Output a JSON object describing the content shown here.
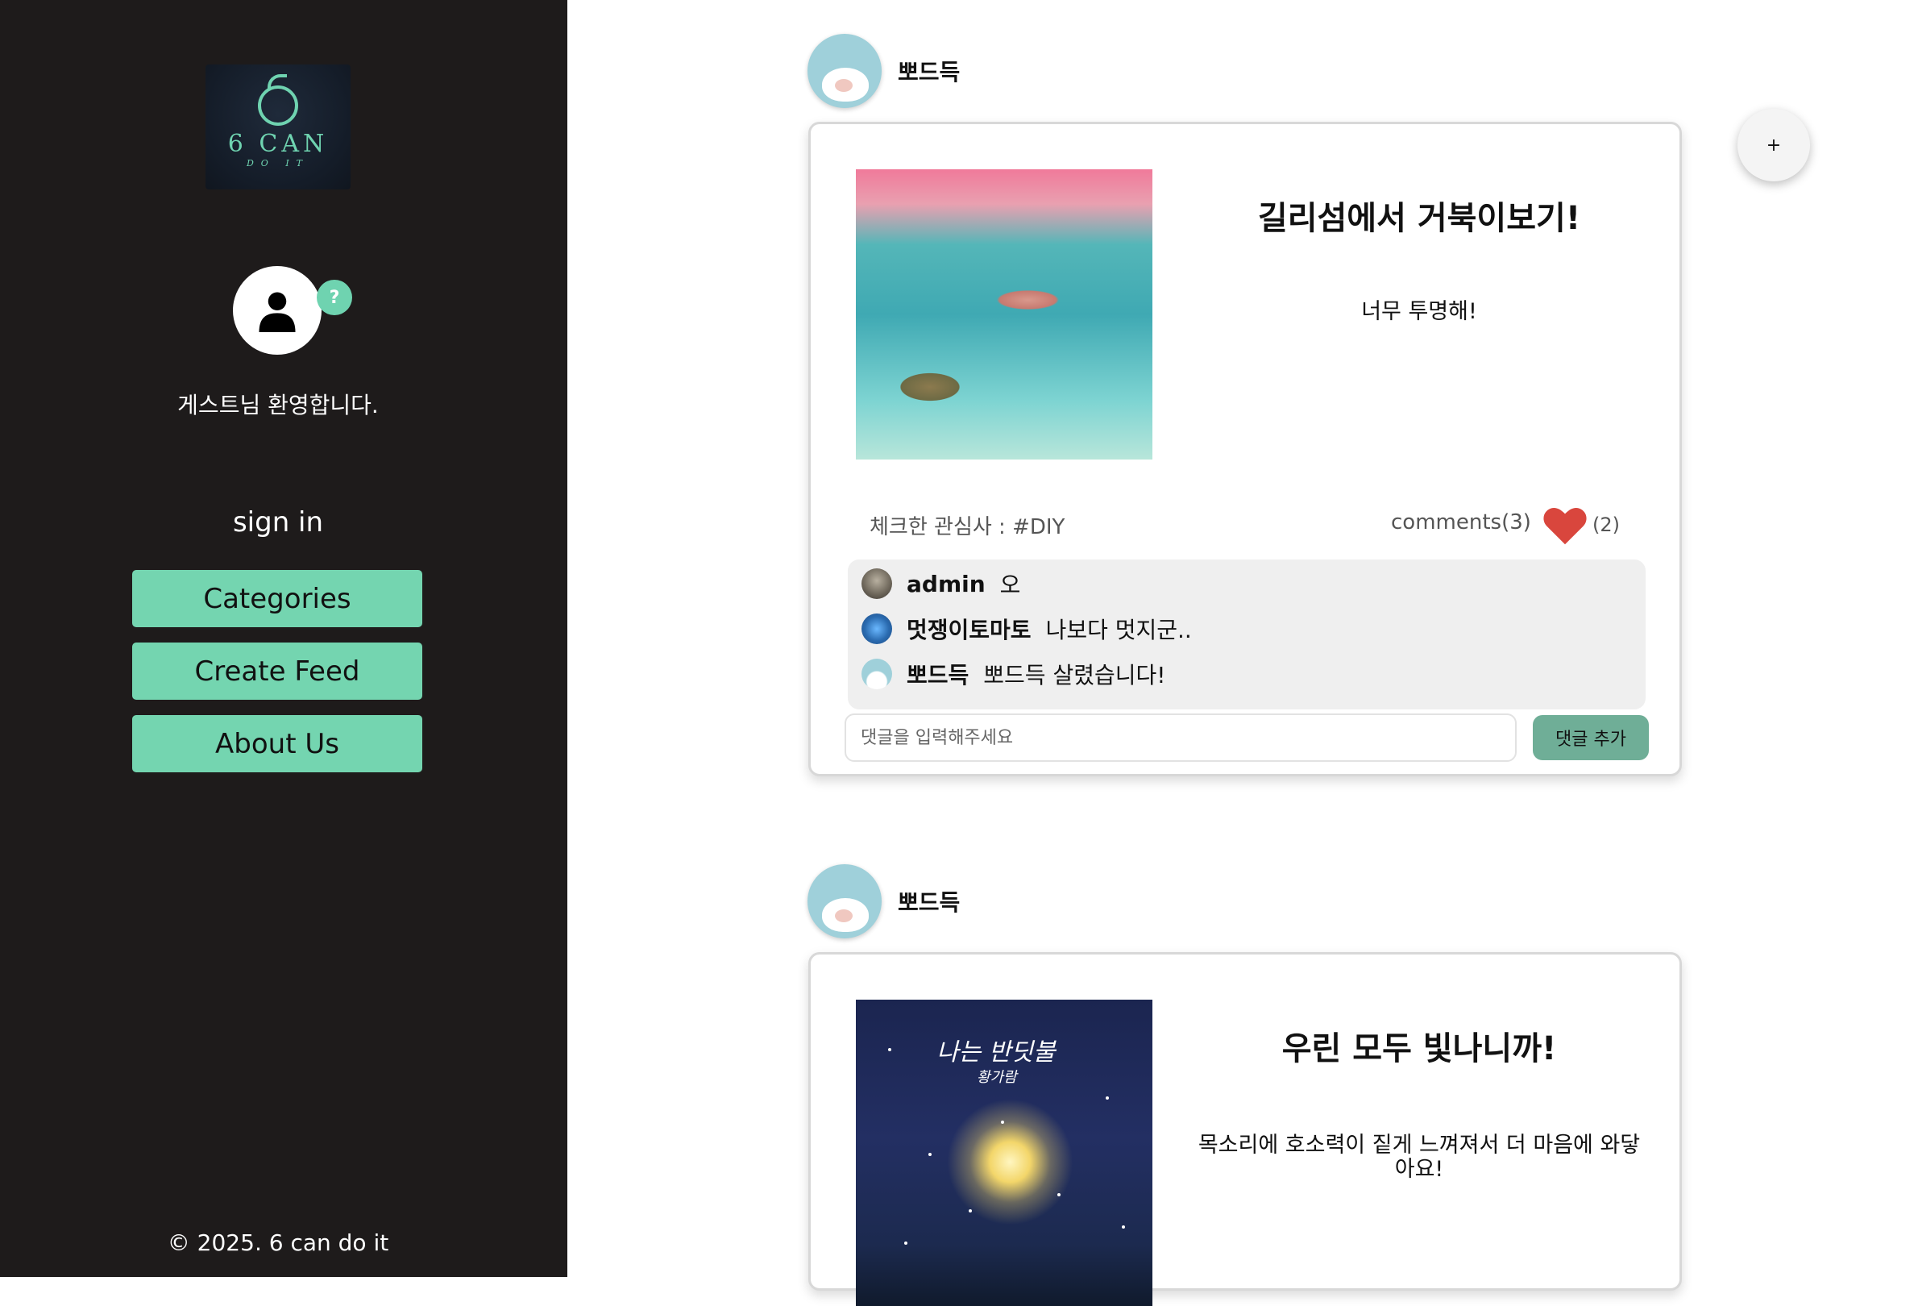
{
  "sidebar": {
    "logo": {
      "main": "6 CAN",
      "sub": "DO IT"
    },
    "help_badge": "?",
    "welcome": "게스트님 환영합니다.",
    "signin": "sign in",
    "nav": [
      "Categories",
      "Create Feed",
      "About Us"
    ],
    "footer": "© 2025. 6 can do it"
  },
  "fab": {
    "label": "+"
  },
  "feeds": [
    {
      "author": "뽀드득",
      "title": "길리섬에서 거북이보기!",
      "body": "너무 투명해!",
      "interest": "체크한 관심사 : #DIY",
      "comments_label": "comments(3)",
      "likes": "(2)",
      "comments": [
        {
          "user": "admin",
          "text": "오"
        },
        {
          "user": "멋쟁이토마토",
          "text": "나보다 멋지군.."
        },
        {
          "user": "뽀드득",
          "text": "뽀드득 살렸습니다!"
        }
      ],
      "comment_placeholder": "댓글을 입력해주세요",
      "comment_submit": "댓글 추가"
    },
    {
      "author": "뽀드득",
      "title": "우린 모두 빛나니까!",
      "body": "목소리에 호소력이 짙게 느껴져서 더 마음에 와닿아요!",
      "image_text": "나는 반딧불",
      "image_subtext": "황가람"
    }
  ],
  "colors": {
    "sidebar_bg": "#1e1b1b",
    "accent": "#74d5b0",
    "submit": "#6fae97",
    "heart": "#d9463d"
  }
}
